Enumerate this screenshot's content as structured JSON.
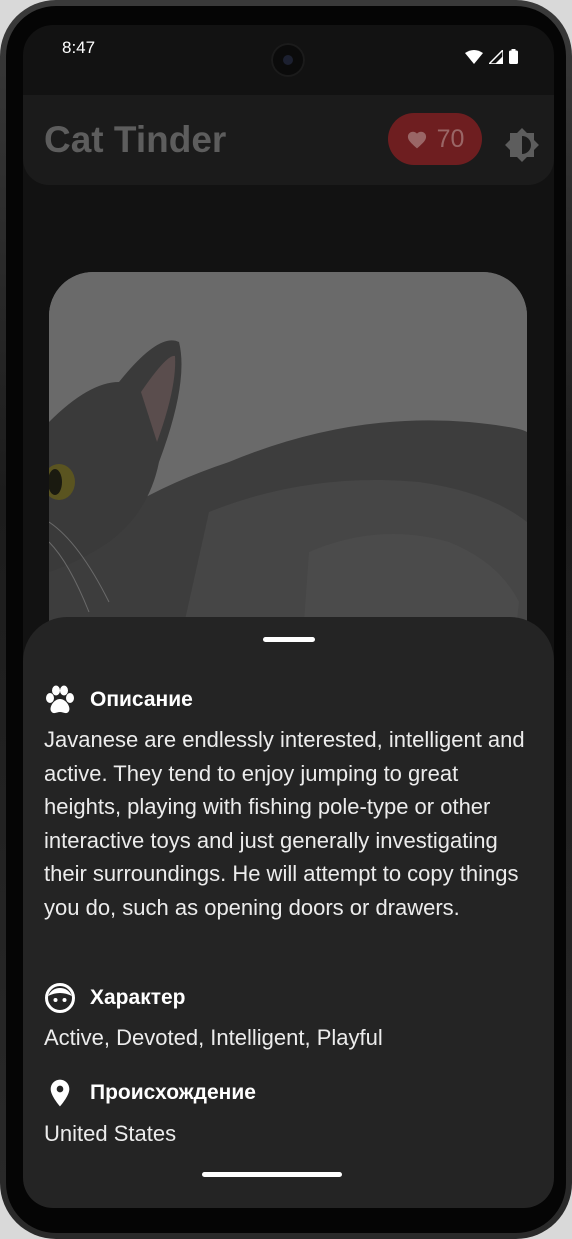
{
  "status_bar": {
    "time": "8:47"
  },
  "app_bar": {
    "title": "Cat Tinder",
    "likes_count": "70",
    "likes_icon": "heart-icon",
    "theme_icon": "brightness-icon"
  },
  "sheet": {
    "description": {
      "icon": "paw-icon",
      "title": "Описание",
      "text": "Javanese are endlessly interested, intelligent and active. They tend to enjoy jumping to great heights, playing with fishing pole-type or other interactive toys and just generally investigating their surroundings. He will attempt to copy things you do, such as opening doors or drawers."
    },
    "temperament": {
      "icon": "face-icon",
      "title": "Характер",
      "text": "Active, Devoted, Intelligent, Playful"
    },
    "origin": {
      "icon": "location-pin-icon",
      "title": "Происхождение",
      "text": "United States"
    }
  },
  "colors": {
    "background": "#121212",
    "sheet": "#242424",
    "likes_chip": "#6e1e20"
  }
}
